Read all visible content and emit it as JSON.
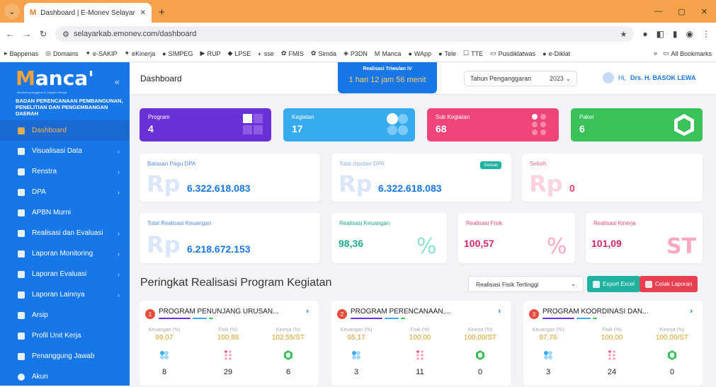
{
  "browser": {
    "tab_title": "Dashboard | E-Monev Selayar",
    "url": "selayarkab.emonev.com/dashboard",
    "bookmarks": [
      "Bappenas",
      "Domains",
      "e-SAKIP",
      "eKinerja",
      "SIMPEG",
      "RUP",
      "LPSE",
      "sse",
      "FMIS",
      "Simda",
      "P3DN",
      "Manca",
      "WApp",
      "Tele",
      "TTE",
      "Pusdiklatwas",
      "e-Diklat"
    ],
    "all_bookmarks": "All Bookmarks"
  },
  "sidebar": {
    "logo": "anca'",
    "logo_m": "M",
    "tagline": "Monitoring Anggaran & Capaian Kinerja",
    "org": "BADAN PERENCANAAN PEMBANGUNAN, PENELITIAN DAN PENGEMBANGAN DAERAH",
    "items": [
      {
        "label": "Dashboard"
      },
      {
        "label": "Visualisasi Data"
      },
      {
        "label": "Renstra"
      },
      {
        "label": "DPA"
      },
      {
        "label": "APBN Murni"
      },
      {
        "label": "Realisasi dan Evaluasi"
      },
      {
        "label": "Laporan Monitoring"
      },
      {
        "label": "Laporan Evaluasi"
      },
      {
        "label": "Laporan Lainnya"
      },
      {
        "label": "Arsip"
      },
      {
        "label": "Profil Unit Kerja"
      },
      {
        "label": "Penanggung Jawab"
      },
      {
        "label": "Akun"
      }
    ]
  },
  "header": {
    "title": "Dashboard",
    "countdown_label": "Realisasi Triwulan IV",
    "countdown_value": "1 hari 12 jam 56 menit",
    "year_label": "Tahun Penganggaran",
    "year_value": "2023",
    "greeting": "Hi,",
    "user": "Drs. H. BASOK LEWA"
  },
  "stats": [
    {
      "label": "Program",
      "value": "4",
      "color": "#6a30d8"
    },
    {
      "label": "Kegiatan",
      "value": "17",
      "color": "#38aaf0"
    },
    {
      "label": "Sub Kegiatan",
      "value": "68",
      "color": "#f0457a"
    },
    {
      "label": "Paket",
      "value": "6",
      "color": "#3ac25a"
    }
  ],
  "pagu": {
    "batasan_label": "Batasan Pagu DPA",
    "batasan_value": "6.322.618.083",
    "total_label": "Total Inputan DPA",
    "total_value": "6.322.618.083",
    "badge": "Sesuai",
    "selisih_label": "Selisih",
    "selisih_value": "0",
    "rp": "Rp"
  },
  "realisasi": {
    "total_label": "Total Realisasi Keuangan",
    "total_value": "6.218.672.153",
    "keu_label": "Realisasi Keuangan",
    "keu_value": "98,36",
    "keu_unit": "%",
    "fisik_label": "Realisasi Fisik",
    "fisik_value": "100,57",
    "fisik_unit": "%",
    "kinerja_label": "Realisasi Kinerja",
    "kinerja_value": "101,09",
    "kinerja_unit": "ST"
  },
  "ranking": {
    "title": "Peringkat Realisasi Program Kegiatan",
    "filter": "Realisasi Fisik Tertinggi",
    "export": "Export Excel",
    "print": "Cetak Laporan",
    "col_keu": "Keuangan (%)",
    "col_fisik": "Fisik (%)",
    "col_kinerja": "Kinerja (%)",
    "programs": [
      {
        "rank": "1",
        "name": "PROGRAM PENUNJANG URUSAN...",
        "keu": "99,07",
        "fisik": "100,88",
        "kinerja": "102,55/ST",
        "c1": "8",
        "c2": "29",
        "c3": "6"
      },
      {
        "rank": "2",
        "name": "PROGRAM PERENCANAAN,...",
        "keu": "95,17",
        "fisik": "100,00",
        "kinerja": "100,00/ST",
        "c1": "3",
        "c2": "11",
        "c3": "0"
      },
      {
        "rank": "3",
        "name": "PROGRAM KOORDINASI DAN...",
        "keu": "97,76",
        "fisik": "100,00",
        "kinerja": "100,00/ST",
        "c1": "3",
        "c2": "24",
        "c3": "0"
      }
    ]
  }
}
